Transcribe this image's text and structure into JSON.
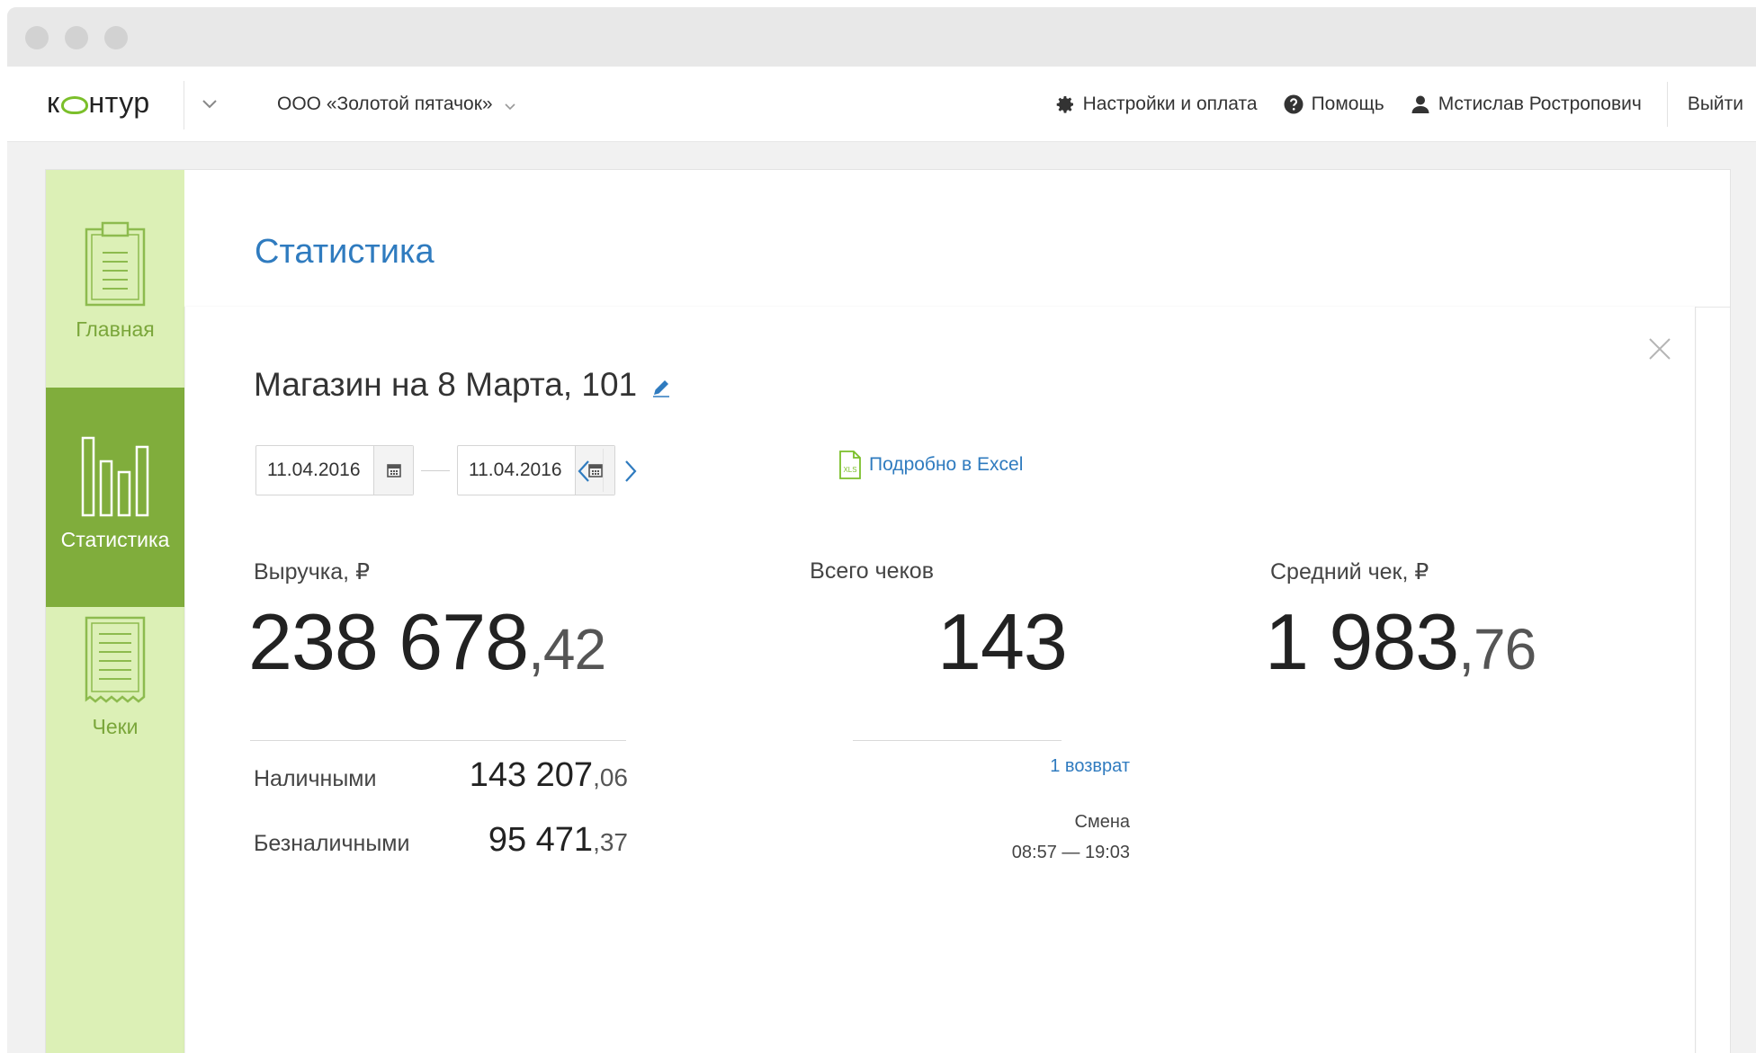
{
  "app": {
    "logo": {
      "pre": "к",
      "post": "нтур"
    },
    "organization": "ООО «Золотой пятачок»",
    "nav": {
      "settings": "Настройки и оплата",
      "help": "Помощь",
      "user": "Мстислав Ростропович",
      "logout": "Выйти"
    }
  },
  "sidebar": {
    "items": [
      {
        "label": "Главная",
        "icon": "clipboard-icon",
        "active": false
      },
      {
        "label": "Статистика",
        "icon": "bar-chart-icon",
        "active": true
      },
      {
        "label": "Чеки",
        "icon": "receipt-icon",
        "active": false
      }
    ]
  },
  "page": {
    "title": "Статистика",
    "store_name": "Магазин на 8 Марта, 101",
    "date_from": "11.04.2016",
    "date_to": "11.04.2016",
    "excel_link": "Подробно в Excel",
    "excel_badge": "XLS"
  },
  "metrics": {
    "revenue": {
      "label": "Выручка, ₽",
      "int": "238 678",
      "frac": ",42"
    },
    "checks": {
      "label": "Всего чеков",
      "value": "143"
    },
    "average": {
      "label": "Средний чек, ₽",
      "int": "1 983",
      "frac": ",76"
    }
  },
  "payments": {
    "cash": {
      "label": "Наличными",
      "int": "143 207",
      "frac": ",06"
    },
    "cashless": {
      "label": "Безналичными",
      "int": "95 471",
      "frac": ",37"
    }
  },
  "details": {
    "refunds": "1 возврат",
    "shift_label": "Смена",
    "shift_time": "08:57 — 19:03"
  },
  "colors": {
    "accent_blue": "#2f7bbf",
    "sidebar_green": "#dcf0b6",
    "active_green": "#80ad3c",
    "logo_green": "#7bbf2a"
  }
}
